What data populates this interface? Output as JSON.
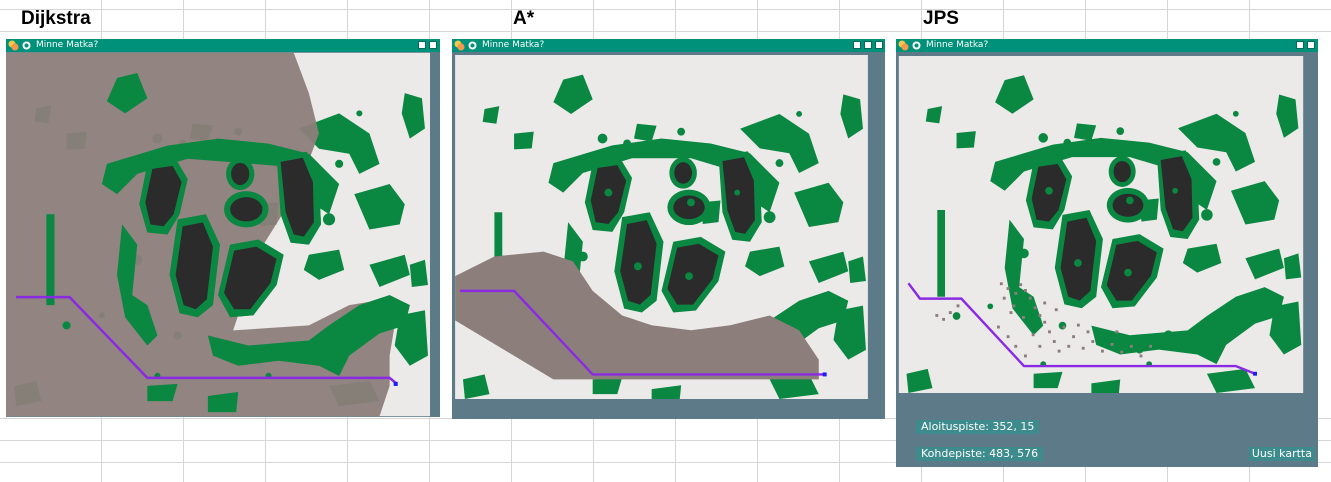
{
  "sheet": {
    "headers": [
      {
        "id": "dijkstra",
        "label": "Dijkstra"
      },
      {
        "id": "astar",
        "label": "A*"
      },
      {
        "id": "jps",
        "label": "JPS"
      }
    ]
  },
  "windows": [
    {
      "id": "dijkstra",
      "title": "Minne Matka?"
    },
    {
      "id": "astar",
      "title": "Minne Matka?"
    },
    {
      "id": "jps",
      "title": "Minne Matka?"
    }
  ],
  "jps_panel": {
    "start_label": "Aloituspiste: 352, 15",
    "goal_label": "Kohdepiste: 483, 576",
    "new_map_button": "Uusi kartta"
  },
  "colors": {
    "terrain_open": "#ece9e9",
    "terrain_forest": "#0a8741",
    "terrain_water": "#2b2b2b",
    "visited": "#8c7e7b",
    "path": "#8a2be2",
    "endpoint": "#1a1aff",
    "titlebar": "#00917a",
    "window_frame": "#5d7a89",
    "label_bg": "#3d8b8c"
  },
  "icons": [
    "app-logo-icon",
    "app-menu-icon",
    "minimize-icon",
    "maximize-icon",
    "close-icon"
  ]
}
